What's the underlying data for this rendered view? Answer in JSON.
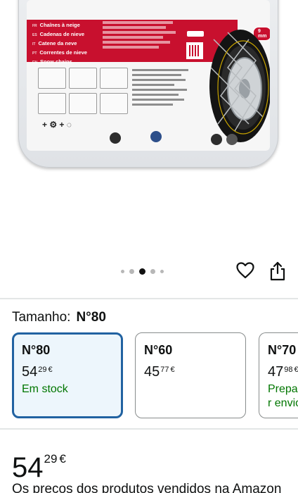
{
  "product_image": {
    "languages": [
      {
        "code": "FR",
        "label": "Chaînes à neige"
      },
      {
        "code": "ES",
        "label": "Cadenas de nieve"
      },
      {
        "code": "IT",
        "label": "Catene da neve"
      },
      {
        "code": "PT",
        "label": "Correntes de nieve"
      },
      {
        "code": "EN",
        "label": "Snow chains"
      }
    ],
    "size_badge": "9 mm",
    "carousel": {
      "count": 5,
      "active_index": 2
    }
  },
  "size_selector": {
    "label": "Tamanho:",
    "selected_value": "N°80",
    "options": [
      {
        "title": "N°80",
        "price_whole": "54",
        "price_fraction": "29",
        "currency": "€",
        "status": "Em stock",
        "selected": true
      },
      {
        "title": "N°60",
        "price_whole": "45",
        "price_fraction": "77",
        "currency": "€",
        "status": "",
        "selected": false
      },
      {
        "title": "N°70",
        "price_whole": "47",
        "price_fraction": "98",
        "currency": "€",
        "status": "Preparar envio",
        "selected": false
      }
    ]
  },
  "price": {
    "whole": "54",
    "fraction": "29",
    "currency": "€"
  },
  "price_note": "Os preços dos produtos vendidos na Amazon",
  "colors": {
    "accent_blue": "#2162a1",
    "selected_bg": "#edf6fc",
    "stock_green": "#007600",
    "package_red": "#c8102e"
  },
  "icons": [
    "heart-icon",
    "share-icon"
  ]
}
